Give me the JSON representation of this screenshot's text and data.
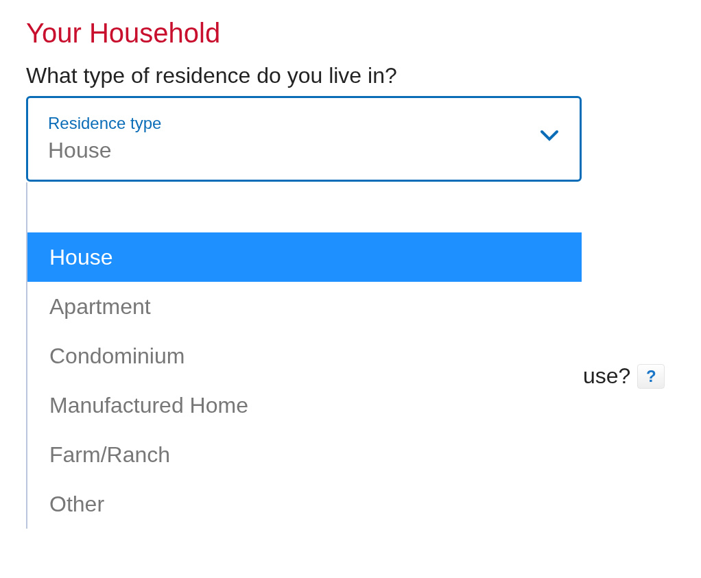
{
  "heading": "Your Household",
  "question": "What type of residence do you live in?",
  "select": {
    "label": "Residence type",
    "value": "House",
    "expanded": true
  },
  "options": [
    {
      "label": "House",
      "selected": true
    },
    {
      "label": "Apartment",
      "selected": false
    },
    {
      "label": "Condominium",
      "selected": false
    },
    {
      "label": "Manufactured Home",
      "selected": false
    },
    {
      "label": "Farm/Ranch",
      "selected": false
    },
    {
      "label": "Other",
      "selected": false
    }
  ],
  "next_question": {
    "text": "use?",
    "help": "?"
  }
}
